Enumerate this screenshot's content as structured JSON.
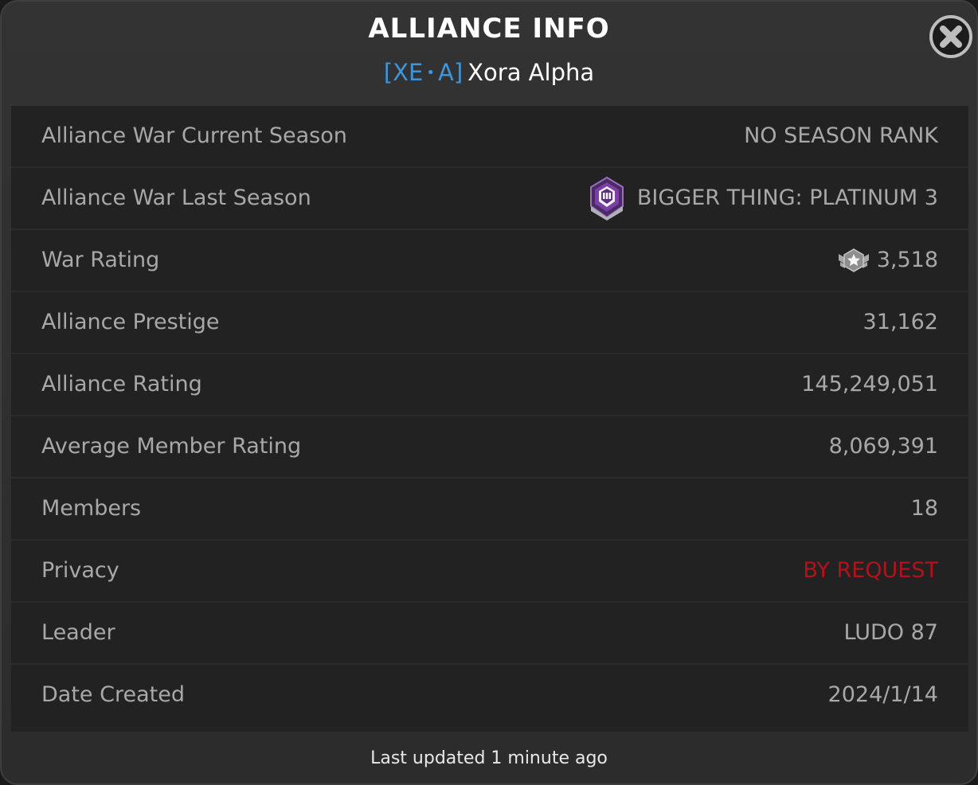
{
  "header": {
    "title": "ALLIANCE INFO",
    "tag_open": "[XE",
    "tag_dot": "•",
    "tag_close": "A]",
    "alliance_name": "Xora Alpha"
  },
  "rows": [
    {
      "label": "Alliance War Current Season",
      "value": "NO SEASON RANK"
    },
    {
      "label": "Alliance War Last Season",
      "value": "BIGGER THING: PLATINUM 3",
      "icon": "platinum-3-rank-badge-icon"
    },
    {
      "label": "War Rating",
      "value": "3,518",
      "icon": "war-rating-emblem-icon"
    },
    {
      "label": "Alliance Prestige",
      "value": "31,162"
    },
    {
      "label": "Alliance Rating",
      "value": "145,249,051"
    },
    {
      "label": "Average Member Rating",
      "value": "8,069,391"
    },
    {
      "label": "Members",
      "value": "18"
    },
    {
      "label": "Privacy",
      "value": "BY REQUEST"
    },
    {
      "label": "Leader",
      "value": "LUDO 87"
    },
    {
      "label": "Date Created",
      "value": "2024/1/14"
    }
  ],
  "footer": {
    "last_updated": "Last updated 1 minute ago"
  },
  "colors": {
    "tag_blue": "#3f95d9",
    "privacy_red": "#b3121a",
    "label_gray": "#a8a8a8",
    "badge_purple": "#7b3fa6"
  },
  "icons": {
    "close": "close-icon"
  }
}
